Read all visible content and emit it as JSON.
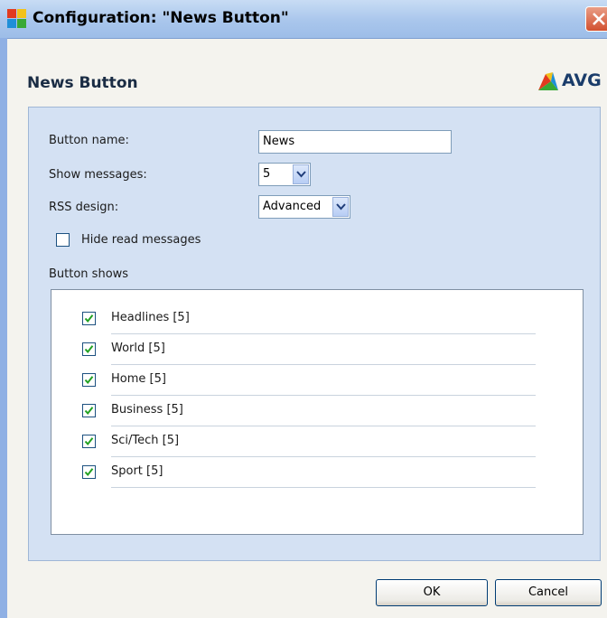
{
  "window": {
    "title": "Configuration: \"News Button\"",
    "icon": "avg-logo-icon",
    "close_icon": "close-icon"
  },
  "header": {
    "title": "News Button",
    "logo_text": "AVG"
  },
  "form": {
    "button_name_label": "Button name:",
    "button_name_value": "News",
    "show_messages_label": "Show messages:",
    "show_messages_value": "5",
    "rss_design_label": "RSS design:",
    "rss_design_value": "Advanced",
    "hide_read_label": "Hide read messages",
    "hide_read_checked": false,
    "button_shows_label": "Button shows"
  },
  "feeds": [
    {
      "label": "Headlines [5]",
      "checked": true
    },
    {
      "label": "World [5]",
      "checked": true
    },
    {
      "label": "Home [5]",
      "checked": true
    },
    {
      "label": "Business [5]",
      "checked": true
    },
    {
      "label": "Sci/Tech [5]",
      "checked": true
    },
    {
      "label": "Sport [5]",
      "checked": true
    }
  ],
  "footer": {
    "ok_label": "OK",
    "cancel_label": "Cancel"
  },
  "colors": {
    "panel": "#d4e1f3",
    "check": "#21a121"
  }
}
